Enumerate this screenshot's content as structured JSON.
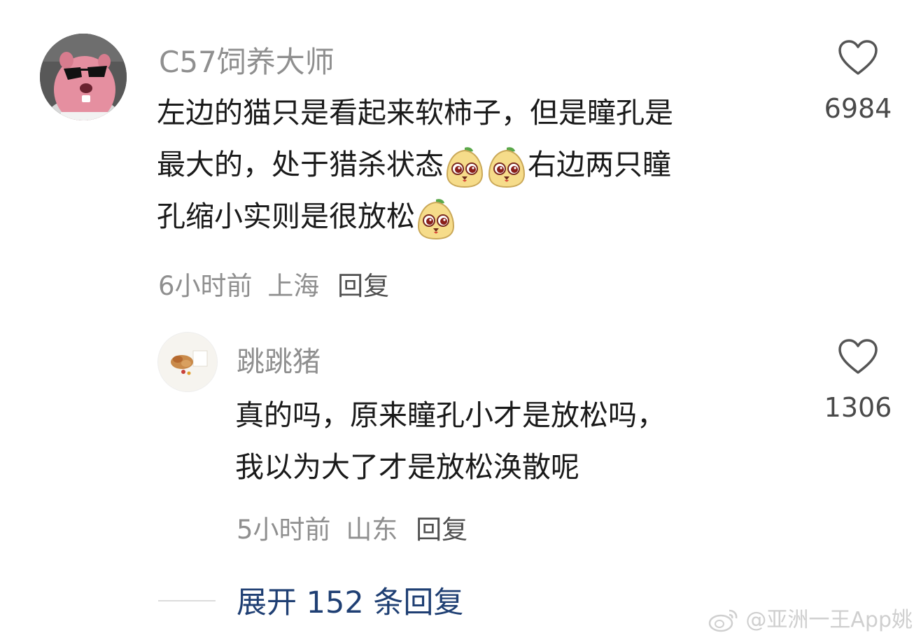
{
  "comments": [
    {
      "username": "C57饲养大师",
      "lines": [
        [
          "左边的猫只是看起来软柿子，但是瞳孔是"
        ],
        [
          "最大的，处于猎杀状态",
          "[emoji]",
          "[emoji]",
          "右边两只瞳"
        ],
        [
          "孔缩小实则是很放松",
          "[emoji]"
        ]
      ],
      "line1": "左边的猫只是看起来软柿子，但是瞳孔是",
      "line2a": "最大的，处于猎杀状态",
      "line2b": "右边两只瞳",
      "line3": "孔缩小实则是很放松",
      "time": "6小时前",
      "location": "上海",
      "reply_label": "回复",
      "like_count": "6984",
      "avatar_icon": "pink-beaver-sunglasses-avatar",
      "emoji_icon": "pear-face-emoji"
    },
    {
      "username": "跳跳猪",
      "line1": "真的吗，原来瞳孔小才是放松吗，",
      "line2": "我以为大了才是放松涣散呢",
      "time": "5小时前",
      "location": "山东",
      "reply_label": "回复",
      "like_count": "1306",
      "avatar_icon": "food-photo-avatar"
    }
  ],
  "expand_label": "展开 152 条回复",
  "watermark": "@亚洲一王App姚",
  "colors": {
    "username": "#8f8f8f",
    "content": "#1a1a1a",
    "meta": "#8f8f8f",
    "expand": "#1f3f73"
  }
}
